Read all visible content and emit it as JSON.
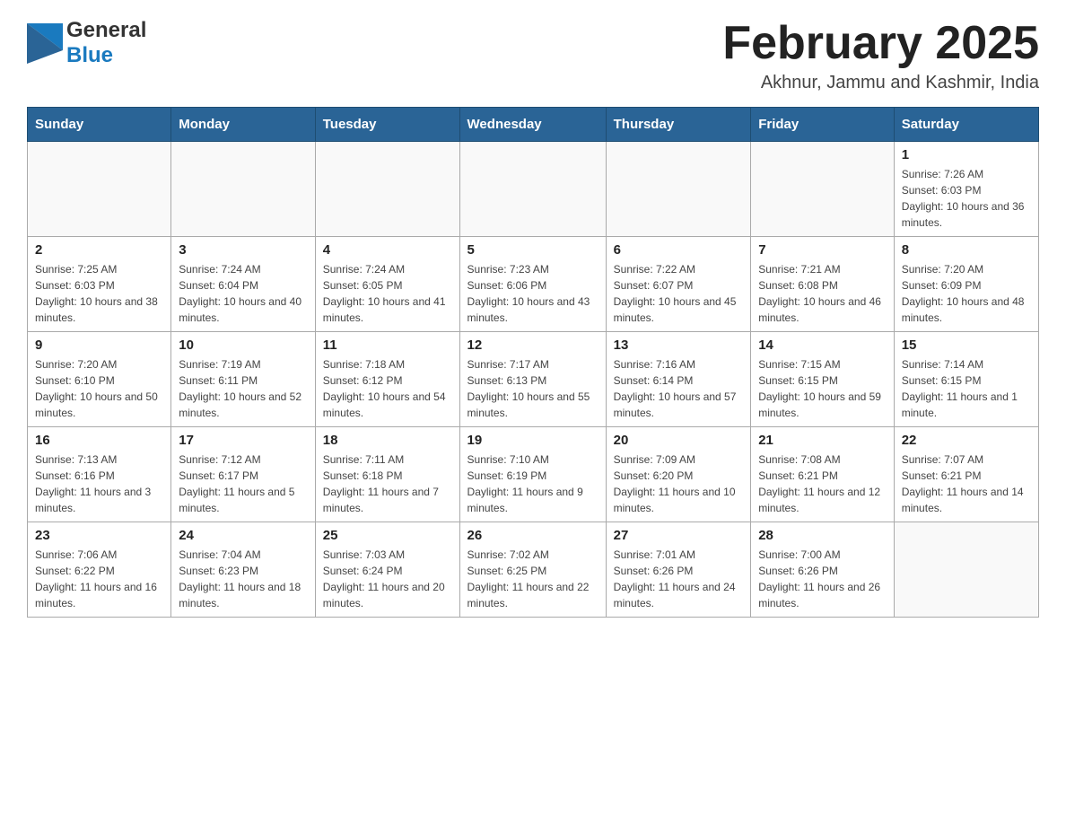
{
  "logo": {
    "general": "General",
    "blue": "Blue"
  },
  "header": {
    "title": "February 2025",
    "subtitle": "Akhnur, Jammu and Kashmir, India"
  },
  "weekdays": [
    "Sunday",
    "Monday",
    "Tuesday",
    "Wednesday",
    "Thursday",
    "Friday",
    "Saturday"
  ],
  "weeks": [
    [
      {
        "day": "",
        "info": ""
      },
      {
        "day": "",
        "info": ""
      },
      {
        "day": "",
        "info": ""
      },
      {
        "day": "",
        "info": ""
      },
      {
        "day": "",
        "info": ""
      },
      {
        "day": "",
        "info": ""
      },
      {
        "day": "1",
        "info": "Sunrise: 7:26 AM\nSunset: 6:03 PM\nDaylight: 10 hours and 36 minutes."
      }
    ],
    [
      {
        "day": "2",
        "info": "Sunrise: 7:25 AM\nSunset: 6:03 PM\nDaylight: 10 hours and 38 minutes."
      },
      {
        "day": "3",
        "info": "Sunrise: 7:24 AM\nSunset: 6:04 PM\nDaylight: 10 hours and 40 minutes."
      },
      {
        "day": "4",
        "info": "Sunrise: 7:24 AM\nSunset: 6:05 PM\nDaylight: 10 hours and 41 minutes."
      },
      {
        "day": "5",
        "info": "Sunrise: 7:23 AM\nSunset: 6:06 PM\nDaylight: 10 hours and 43 minutes."
      },
      {
        "day": "6",
        "info": "Sunrise: 7:22 AM\nSunset: 6:07 PM\nDaylight: 10 hours and 45 minutes."
      },
      {
        "day": "7",
        "info": "Sunrise: 7:21 AM\nSunset: 6:08 PM\nDaylight: 10 hours and 46 minutes."
      },
      {
        "day": "8",
        "info": "Sunrise: 7:20 AM\nSunset: 6:09 PM\nDaylight: 10 hours and 48 minutes."
      }
    ],
    [
      {
        "day": "9",
        "info": "Sunrise: 7:20 AM\nSunset: 6:10 PM\nDaylight: 10 hours and 50 minutes."
      },
      {
        "day": "10",
        "info": "Sunrise: 7:19 AM\nSunset: 6:11 PM\nDaylight: 10 hours and 52 minutes."
      },
      {
        "day": "11",
        "info": "Sunrise: 7:18 AM\nSunset: 6:12 PM\nDaylight: 10 hours and 54 minutes."
      },
      {
        "day": "12",
        "info": "Sunrise: 7:17 AM\nSunset: 6:13 PM\nDaylight: 10 hours and 55 minutes."
      },
      {
        "day": "13",
        "info": "Sunrise: 7:16 AM\nSunset: 6:14 PM\nDaylight: 10 hours and 57 minutes."
      },
      {
        "day": "14",
        "info": "Sunrise: 7:15 AM\nSunset: 6:15 PM\nDaylight: 10 hours and 59 minutes."
      },
      {
        "day": "15",
        "info": "Sunrise: 7:14 AM\nSunset: 6:15 PM\nDaylight: 11 hours and 1 minute."
      }
    ],
    [
      {
        "day": "16",
        "info": "Sunrise: 7:13 AM\nSunset: 6:16 PM\nDaylight: 11 hours and 3 minutes."
      },
      {
        "day": "17",
        "info": "Sunrise: 7:12 AM\nSunset: 6:17 PM\nDaylight: 11 hours and 5 minutes."
      },
      {
        "day": "18",
        "info": "Sunrise: 7:11 AM\nSunset: 6:18 PM\nDaylight: 11 hours and 7 minutes."
      },
      {
        "day": "19",
        "info": "Sunrise: 7:10 AM\nSunset: 6:19 PM\nDaylight: 11 hours and 9 minutes."
      },
      {
        "day": "20",
        "info": "Sunrise: 7:09 AM\nSunset: 6:20 PM\nDaylight: 11 hours and 10 minutes."
      },
      {
        "day": "21",
        "info": "Sunrise: 7:08 AM\nSunset: 6:21 PM\nDaylight: 11 hours and 12 minutes."
      },
      {
        "day": "22",
        "info": "Sunrise: 7:07 AM\nSunset: 6:21 PM\nDaylight: 11 hours and 14 minutes."
      }
    ],
    [
      {
        "day": "23",
        "info": "Sunrise: 7:06 AM\nSunset: 6:22 PM\nDaylight: 11 hours and 16 minutes."
      },
      {
        "day": "24",
        "info": "Sunrise: 7:04 AM\nSunset: 6:23 PM\nDaylight: 11 hours and 18 minutes."
      },
      {
        "day": "25",
        "info": "Sunrise: 7:03 AM\nSunset: 6:24 PM\nDaylight: 11 hours and 20 minutes."
      },
      {
        "day": "26",
        "info": "Sunrise: 7:02 AM\nSunset: 6:25 PM\nDaylight: 11 hours and 22 minutes."
      },
      {
        "day": "27",
        "info": "Sunrise: 7:01 AM\nSunset: 6:26 PM\nDaylight: 11 hours and 24 minutes."
      },
      {
        "day": "28",
        "info": "Sunrise: 7:00 AM\nSunset: 6:26 PM\nDaylight: 11 hours and 26 minutes."
      },
      {
        "day": "",
        "info": ""
      }
    ]
  ]
}
